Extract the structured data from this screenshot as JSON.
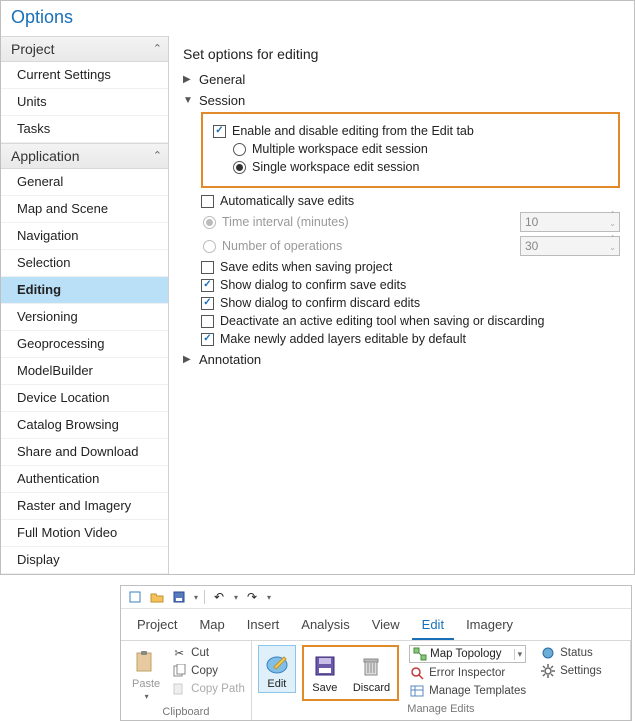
{
  "window_title": "Options",
  "sidebar": {
    "groups": [
      {
        "label": "Project",
        "items": [
          "Current Settings",
          "Units",
          "Tasks"
        ]
      },
      {
        "label": "Application",
        "items": [
          "General",
          "Map and Scene",
          "Navigation",
          "Selection",
          "Editing",
          "Versioning",
          "Geoprocessing",
          "ModelBuilder",
          "Device Location",
          "Catalog Browsing",
          "Share and Download",
          "Authentication",
          "Raster and Imagery",
          "Full Motion Video",
          "Display"
        ],
        "selected_index": 4
      }
    ]
  },
  "content": {
    "heading": "Set options for editing",
    "sections": {
      "general": {
        "label": "General",
        "expanded": false
      },
      "session": {
        "label": "Session",
        "enable_disable_label": "Enable and disable editing from the Edit tab",
        "enable_disable_checked": true,
        "radio_multiple": "Multiple workspace edit session",
        "radio_single": "Single workspace edit session",
        "radio_selected": "single",
        "auto_save_label": "Automatically save edits",
        "auto_save_checked": false,
        "time_interval_label": "Time interval (minutes)",
        "time_interval_value": "10",
        "num_ops_label": "Number of operations",
        "num_ops_value": "30",
        "save_on_project_label": "Save edits when saving project",
        "save_on_project_checked": false,
        "confirm_save_label": "Show dialog to confirm save edits",
        "confirm_save_checked": true,
        "confirm_discard_label": "Show dialog to confirm discard edits",
        "confirm_discard_checked": true,
        "deactivate_label": "Deactivate an active editing tool when saving or discarding",
        "deactivate_checked": false,
        "make_editable_label": "Make newly added layers editable by default",
        "make_editable_checked": true
      },
      "annotation": {
        "label": "Annotation",
        "expanded": false
      }
    }
  },
  "ribbon": {
    "tabs": [
      "Project",
      "Map",
      "Insert",
      "Analysis",
      "View",
      "Edit",
      "Imagery"
    ],
    "active_tab": 5,
    "clipboard": {
      "paste": "Paste",
      "cut": "Cut",
      "copy": "Copy",
      "copy_path": "Copy Path",
      "group_label": "Clipboard"
    },
    "manage_edits": {
      "edit": "Edit",
      "save": "Save",
      "discard": "Discard",
      "topology_label": "Map Topology",
      "error_inspector": "Error Inspector",
      "manage_templates": "Manage Templates",
      "status": "Status",
      "settings": "Settings",
      "group_label": "Manage Edits"
    }
  }
}
